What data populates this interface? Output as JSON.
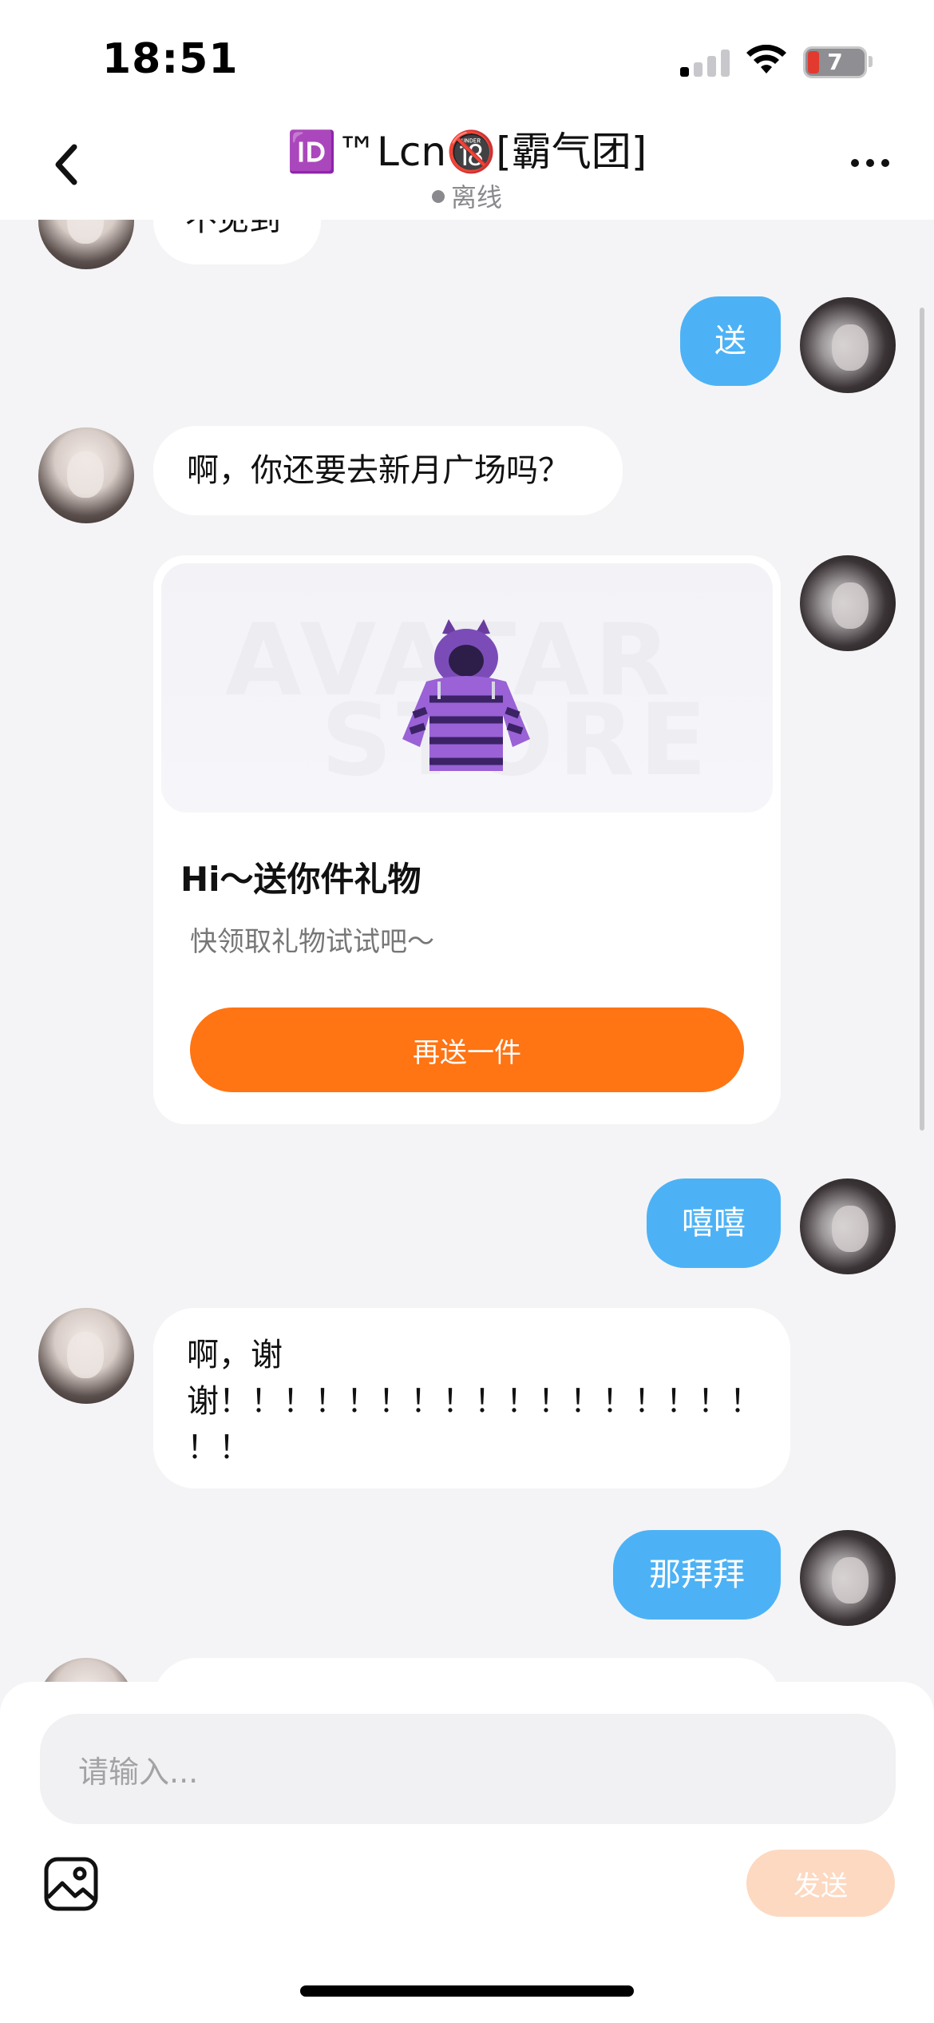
{
  "status_bar": {
    "time": "18:51",
    "battery": "7"
  },
  "header": {
    "title": "🆔™Lcn🔞[霸气团]",
    "status": "离线"
  },
  "messages": [
    {
      "side": "in",
      "text": "不见到"
    },
    {
      "side": "out",
      "text": "送"
    },
    {
      "side": "in",
      "text": "啊，你还要去新月广场吗？"
    },
    {
      "side": "out",
      "type": "gift",
      "banner_watermark_1": "AVATAR",
      "banner_watermark_2": "STORE",
      "title": "Hi～送你件礼物",
      "subtitle": "快领取礼物试试吧～",
      "button": "再送一件"
    },
    {
      "side": "out",
      "text": "嘻嘻"
    },
    {
      "side": "in",
      "lines": [
        "啊，谢",
        "谢！！！！！！！！！！！！！！！！！",
        "！！"
      ]
    },
    {
      "side": "out",
      "text": "那拜拜"
    }
  ],
  "input": {
    "placeholder": "请输入...",
    "send_label": "发送"
  },
  "colors": {
    "bubble_out": "#4db2f5",
    "gift_button": "#ff7413",
    "send_disabled": "#fdd9c1"
  }
}
